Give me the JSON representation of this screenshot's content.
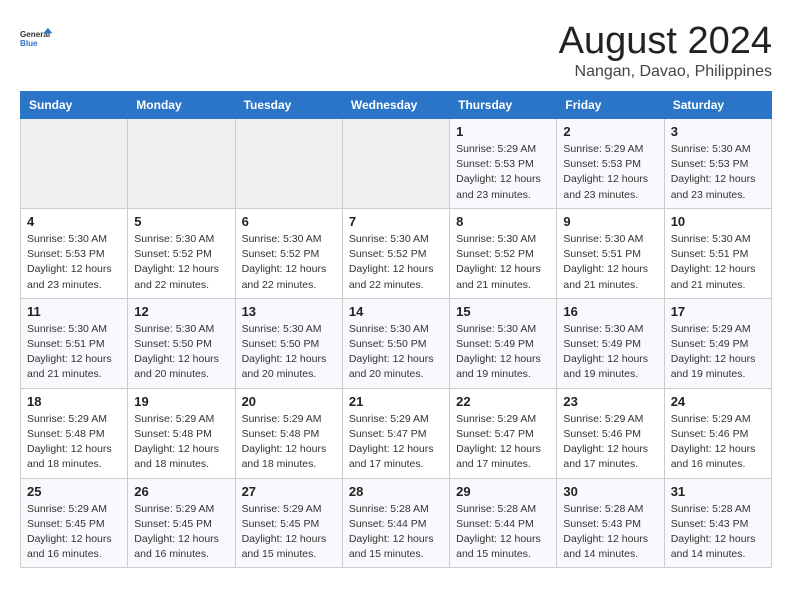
{
  "header": {
    "logo_line1": "General",
    "logo_line2": "Blue",
    "month": "August 2024",
    "location": "Nangan, Davao, Philippines"
  },
  "days_of_week": [
    "Sunday",
    "Monday",
    "Tuesday",
    "Wednesday",
    "Thursday",
    "Friday",
    "Saturday"
  ],
  "weeks": [
    [
      {
        "day": "",
        "info": ""
      },
      {
        "day": "",
        "info": ""
      },
      {
        "day": "",
        "info": ""
      },
      {
        "day": "",
        "info": ""
      },
      {
        "day": "1",
        "info": "Sunrise: 5:29 AM\nSunset: 5:53 PM\nDaylight: 12 hours\nand 23 minutes."
      },
      {
        "day": "2",
        "info": "Sunrise: 5:29 AM\nSunset: 5:53 PM\nDaylight: 12 hours\nand 23 minutes."
      },
      {
        "day": "3",
        "info": "Sunrise: 5:30 AM\nSunset: 5:53 PM\nDaylight: 12 hours\nand 23 minutes."
      }
    ],
    [
      {
        "day": "4",
        "info": "Sunrise: 5:30 AM\nSunset: 5:53 PM\nDaylight: 12 hours\nand 23 minutes."
      },
      {
        "day": "5",
        "info": "Sunrise: 5:30 AM\nSunset: 5:52 PM\nDaylight: 12 hours\nand 22 minutes."
      },
      {
        "day": "6",
        "info": "Sunrise: 5:30 AM\nSunset: 5:52 PM\nDaylight: 12 hours\nand 22 minutes."
      },
      {
        "day": "7",
        "info": "Sunrise: 5:30 AM\nSunset: 5:52 PM\nDaylight: 12 hours\nand 22 minutes."
      },
      {
        "day": "8",
        "info": "Sunrise: 5:30 AM\nSunset: 5:52 PM\nDaylight: 12 hours\nand 21 minutes."
      },
      {
        "day": "9",
        "info": "Sunrise: 5:30 AM\nSunset: 5:51 PM\nDaylight: 12 hours\nand 21 minutes."
      },
      {
        "day": "10",
        "info": "Sunrise: 5:30 AM\nSunset: 5:51 PM\nDaylight: 12 hours\nand 21 minutes."
      }
    ],
    [
      {
        "day": "11",
        "info": "Sunrise: 5:30 AM\nSunset: 5:51 PM\nDaylight: 12 hours\nand 21 minutes."
      },
      {
        "day": "12",
        "info": "Sunrise: 5:30 AM\nSunset: 5:50 PM\nDaylight: 12 hours\nand 20 minutes."
      },
      {
        "day": "13",
        "info": "Sunrise: 5:30 AM\nSunset: 5:50 PM\nDaylight: 12 hours\nand 20 minutes."
      },
      {
        "day": "14",
        "info": "Sunrise: 5:30 AM\nSunset: 5:50 PM\nDaylight: 12 hours\nand 20 minutes."
      },
      {
        "day": "15",
        "info": "Sunrise: 5:30 AM\nSunset: 5:49 PM\nDaylight: 12 hours\nand 19 minutes."
      },
      {
        "day": "16",
        "info": "Sunrise: 5:30 AM\nSunset: 5:49 PM\nDaylight: 12 hours\nand 19 minutes."
      },
      {
        "day": "17",
        "info": "Sunrise: 5:29 AM\nSunset: 5:49 PM\nDaylight: 12 hours\nand 19 minutes."
      }
    ],
    [
      {
        "day": "18",
        "info": "Sunrise: 5:29 AM\nSunset: 5:48 PM\nDaylight: 12 hours\nand 18 minutes."
      },
      {
        "day": "19",
        "info": "Sunrise: 5:29 AM\nSunset: 5:48 PM\nDaylight: 12 hours\nand 18 minutes."
      },
      {
        "day": "20",
        "info": "Sunrise: 5:29 AM\nSunset: 5:48 PM\nDaylight: 12 hours\nand 18 minutes."
      },
      {
        "day": "21",
        "info": "Sunrise: 5:29 AM\nSunset: 5:47 PM\nDaylight: 12 hours\nand 17 minutes."
      },
      {
        "day": "22",
        "info": "Sunrise: 5:29 AM\nSunset: 5:47 PM\nDaylight: 12 hours\nand 17 minutes."
      },
      {
        "day": "23",
        "info": "Sunrise: 5:29 AM\nSunset: 5:46 PM\nDaylight: 12 hours\nand 17 minutes."
      },
      {
        "day": "24",
        "info": "Sunrise: 5:29 AM\nSunset: 5:46 PM\nDaylight: 12 hours\nand 16 minutes."
      }
    ],
    [
      {
        "day": "25",
        "info": "Sunrise: 5:29 AM\nSunset: 5:45 PM\nDaylight: 12 hours\nand 16 minutes."
      },
      {
        "day": "26",
        "info": "Sunrise: 5:29 AM\nSunset: 5:45 PM\nDaylight: 12 hours\nand 16 minutes."
      },
      {
        "day": "27",
        "info": "Sunrise: 5:29 AM\nSunset: 5:45 PM\nDaylight: 12 hours\nand 15 minutes."
      },
      {
        "day": "28",
        "info": "Sunrise: 5:28 AM\nSunset: 5:44 PM\nDaylight: 12 hours\nand 15 minutes."
      },
      {
        "day": "29",
        "info": "Sunrise: 5:28 AM\nSunset: 5:44 PM\nDaylight: 12 hours\nand 15 minutes."
      },
      {
        "day": "30",
        "info": "Sunrise: 5:28 AM\nSunset: 5:43 PM\nDaylight: 12 hours\nand 14 minutes."
      },
      {
        "day": "31",
        "info": "Sunrise: 5:28 AM\nSunset: 5:43 PM\nDaylight: 12 hours\nand 14 minutes."
      }
    ]
  ]
}
